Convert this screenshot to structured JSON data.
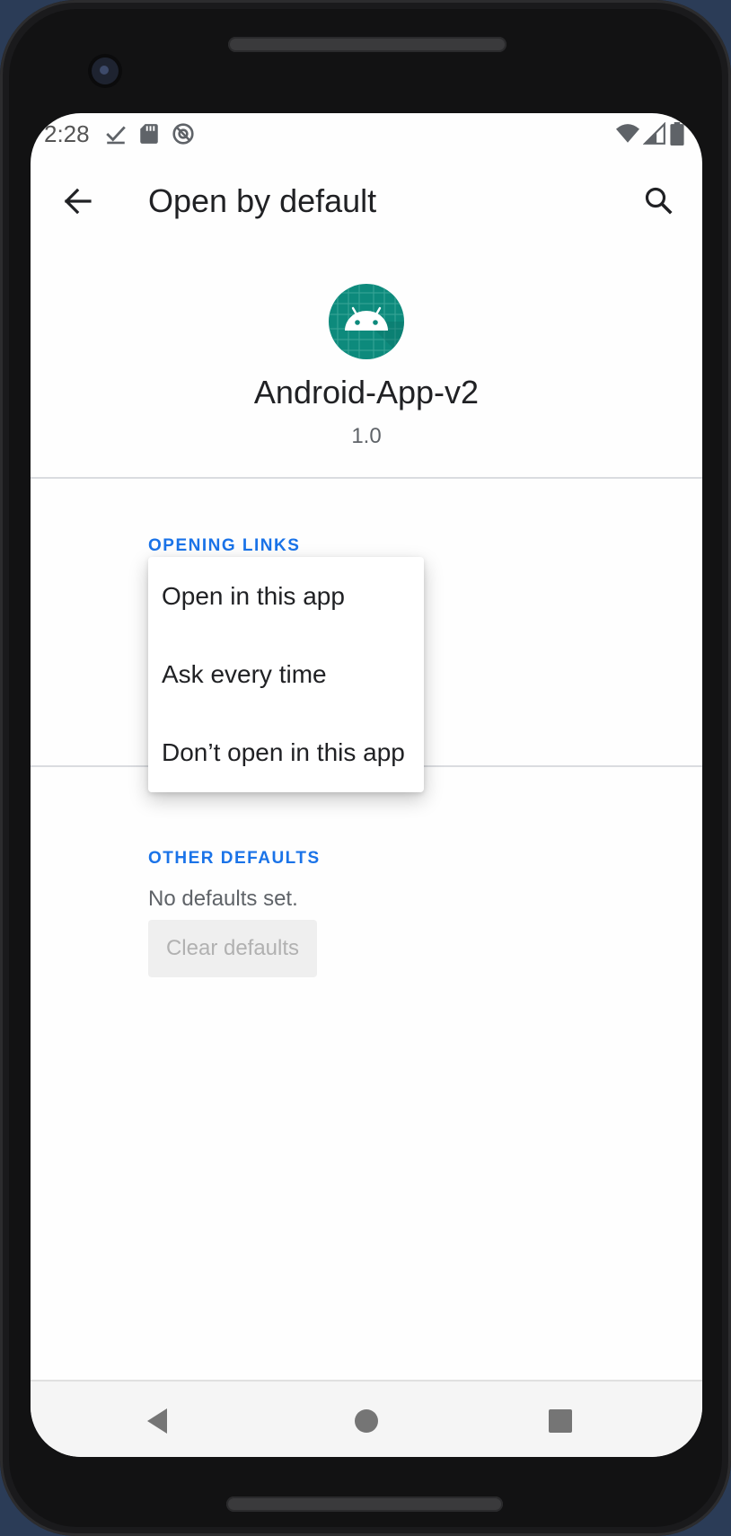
{
  "status_bar": {
    "time": "2:28",
    "icons_left": [
      "check-icon",
      "sd-card-icon",
      "at-sign-icon"
    ],
    "icons_right": [
      "wifi-icon",
      "cell-signal-icon",
      "battery-icon"
    ]
  },
  "app_bar": {
    "title": "Open by default",
    "back_icon": "arrow-back-icon",
    "search_icon": "search-icon"
  },
  "app_header": {
    "name": "Android-App-v2",
    "version": "1.0",
    "icon": "android-robot-icon",
    "icon_color": "#0d8a7c"
  },
  "sections": {
    "opening_links": {
      "header": "OPENING LINKS"
    },
    "other_defaults": {
      "header": "OTHER DEFAULTS",
      "status": "No defaults set.",
      "clear_button": "Clear defaults"
    }
  },
  "dropdown": {
    "options": [
      "Open in this app",
      "Ask every time",
      "Don’t open in this app"
    ]
  },
  "nav_bar": {
    "buttons": [
      "back-triangle-icon",
      "home-circle-icon",
      "recents-square-icon"
    ]
  },
  "colors": {
    "accent": "#1a73e8",
    "text_primary": "#202124",
    "text_secondary": "#5f6368"
  }
}
